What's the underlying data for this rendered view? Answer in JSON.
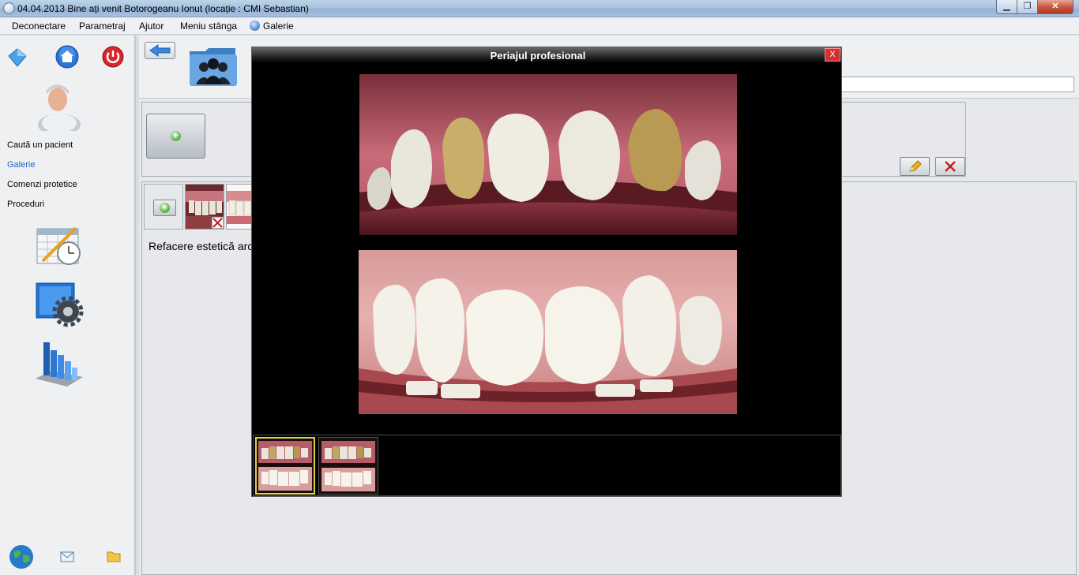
{
  "window": {
    "title": "04.04.2013 Bine ați venit Botorogeanu Ionut (locație : CMI Sebastian)",
    "controls": {
      "minimize": "▁",
      "maximize": "❐",
      "close": "✕"
    }
  },
  "menu": {
    "items": [
      "Deconectare",
      "Parametraj",
      "Ajutor",
      "Meniu stânga",
      "Galerie"
    ]
  },
  "sidebar": {
    "links": [
      {
        "label": "Caută un pacient",
        "active": false
      },
      {
        "label": "Galerie",
        "active": true
      },
      {
        "label": "Comenzi protetice",
        "active": false
      },
      {
        "label": "Proceduri",
        "active": false
      }
    ],
    "top_icons": [
      "diamond-icon",
      "home-icon",
      "power-icon"
    ],
    "tool_icons": [
      "calendar-clock-icon",
      "settings-gear-icon",
      "bar-chart-icon"
    ],
    "bottom_icons": [
      "globe-icon",
      "mail-icon",
      "folder-icon"
    ]
  },
  "gallery": {
    "caption": "Refacere estetică arc"
  },
  "modal": {
    "title": "Periajul profesional",
    "close_label": "X"
  },
  "colors": {
    "accent_link": "#2463c9",
    "modal_close": "#d62f2f",
    "selected_thumb": "#e1d33f"
  }
}
